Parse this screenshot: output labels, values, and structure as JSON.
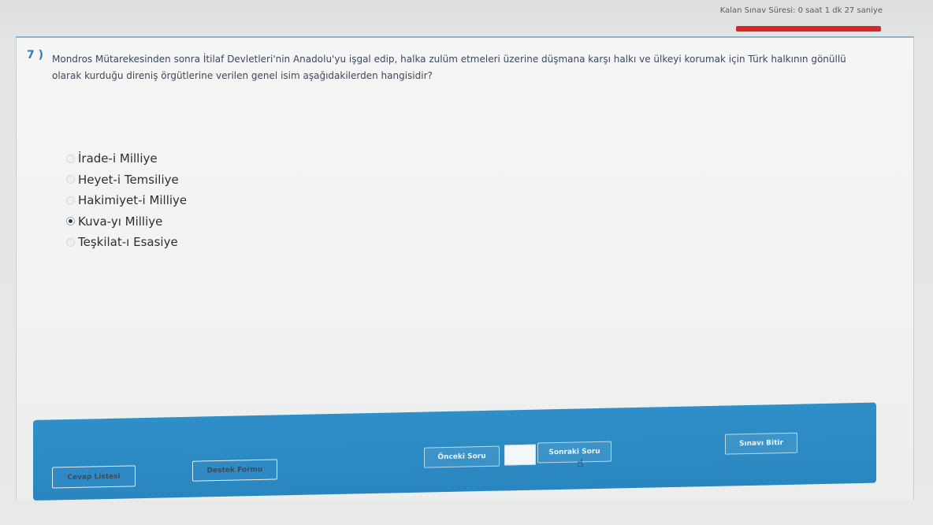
{
  "header": {
    "timer_text": "Kalan Sınav Süresi: 0 saat 1 dk 27 saniye"
  },
  "question": {
    "number": "7 )",
    "text": "Mondros Mütarekesinden sonra İtilaf Devletleri'nin Anadolu'yu işgal edip, halka zulüm etmeleri üzerine düşmana karşı halkı ve ülkeyi korumak için Türk halkının gönüllü olarak kurduğu direniş örgütlerine verilen genel isim aşağıdakilerden hangisidir?"
  },
  "options": [
    {
      "label": "İrade-i Milliye",
      "selected": false
    },
    {
      "label": "Heyet-i Temsiliye",
      "selected": false
    },
    {
      "label": "Hakimiyet-i Milliye",
      "selected": false
    },
    {
      "label": "Kuva-yı Milliye",
      "selected": true
    },
    {
      "label": "Teşkilat-ı Esasiye",
      "selected": false
    }
  ],
  "footer": {
    "answer_list_label": "Cevap Listesi",
    "support_form_label": "Destek Formu",
    "previous_label": "Önceki Soru",
    "next_label": "Sonraki Soru",
    "finish_label": "Sınavı Bitir"
  },
  "colors": {
    "accent": "#2f8fc8",
    "timer_bar": "#d62828",
    "question_number": "#2e7dbf"
  },
  "icons": {
    "cursor": "hand-pointer-icon",
    "radio": "radio-button-icon"
  }
}
